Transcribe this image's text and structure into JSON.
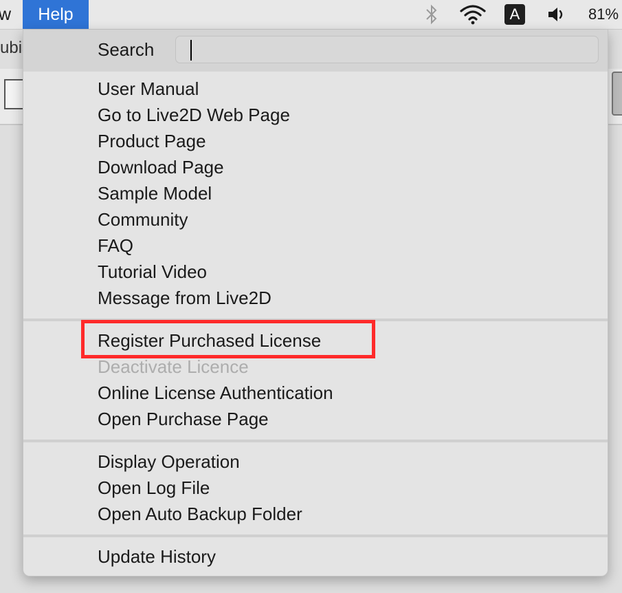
{
  "menubar": {
    "prev_menu_fragment": "w",
    "help_label": "Help",
    "input_source": "A",
    "battery": "81%",
    "icons": [
      "bluetooth-icon",
      "wifi-icon",
      "input-source-icon",
      "volume-icon"
    ]
  },
  "background": {
    "tab_fragment": "ubis"
  },
  "menu": {
    "search_label": "Search",
    "search_value": "",
    "groups": [
      [
        "User Manual",
        "Go to Live2D Web Page",
        "Product Page",
        "Download Page",
        "Sample Model",
        "Community",
        "FAQ",
        "Tutorial Video",
        "Message from Live2D"
      ],
      [
        "Register Purchased License",
        "Deactivate Licence",
        "Online License Authentication",
        "Open Purchase Page"
      ],
      [
        "Display Operation",
        "Open Log File",
        "Open Auto Backup Folder"
      ],
      [
        "Update History"
      ]
    ],
    "items": {
      "user_manual": "User Manual",
      "live2d_web": "Go to Live2D Web Page",
      "product_page": "Product Page",
      "download_page": "Download Page",
      "sample_model": "Sample Model",
      "community": "Community",
      "faq": "FAQ",
      "tutorial_video": "Tutorial Video",
      "message": "Message from Live2D",
      "register_license": "Register Purchased License",
      "deactivate_licence": "Deactivate Licence",
      "online_auth": "Online License Authentication",
      "purchase_page": "Open Purchase Page",
      "display_operation": "Display Operation",
      "open_log": "Open Log File",
      "auto_backup": "Open Auto Backup Folder",
      "update_history": "Update History"
    },
    "disabled": [
      "Deactivate Licence"
    ],
    "highlight_color": "#ff2a2a"
  }
}
